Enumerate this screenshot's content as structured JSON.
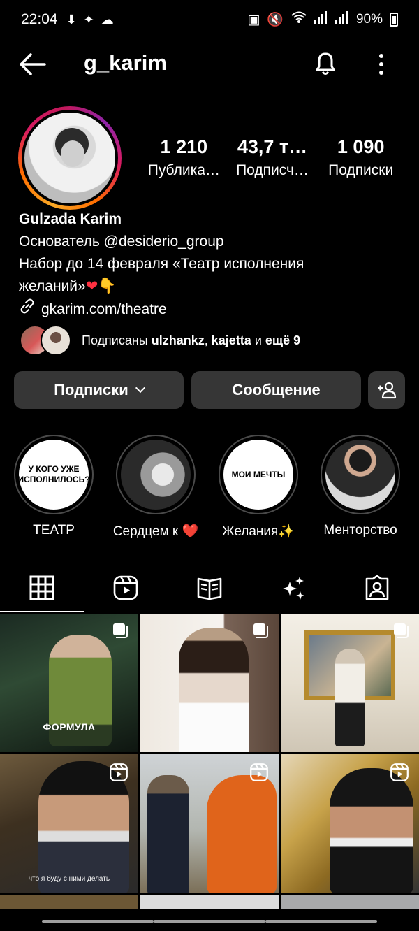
{
  "status_bar": {
    "time": "22:04",
    "battery": "90%"
  },
  "header": {
    "username": "g_karim"
  },
  "stats": [
    {
      "value": "1 210",
      "label": "Публика…"
    },
    {
      "value": "43,7 т…",
      "label": "Подписч…"
    },
    {
      "value": "1 090",
      "label": "Подписки"
    }
  ],
  "bio": {
    "name": "Gulzada Karim",
    "line1": "Основатель @desiderio_group",
    "line2": "Набор до 14 февраля «Театр исполнения",
    "line3_text": "желаний»",
    "link": "gkarim.com/theatre"
  },
  "followed_by": {
    "prefix": "Подписаны ",
    "user1": "ulzhankz",
    "sep": ", ",
    "user2": "kajetta",
    "mid": " и ",
    "more": "ещё 9"
  },
  "buttons": {
    "following": "Подписки",
    "message": "Сообщение"
  },
  "highlights": [
    {
      "label": "ТЕАТР",
      "cover_text": "У КОГО УЖЕ ИСПОЛНИЛОСЬ?"
    },
    {
      "label": "Сердцем к ❤️",
      "cover_text": ""
    },
    {
      "label": "Желания✨",
      "cover_text": "МОИ МЕЧТЫ"
    },
    {
      "label": "Менторство",
      "cover_text": ""
    }
  ],
  "tabs": [
    "grid-icon",
    "reels-icon",
    "guides-icon",
    "effects-icon",
    "tagged-icon"
  ],
  "posts": [
    {
      "caption": "ФОРМУЛА",
      "type": "carousel"
    },
    {
      "caption": "",
      "type": "carousel"
    },
    {
      "caption": "",
      "type": "carousel"
    },
    {
      "caption": "что я буду с ними делать",
      "type": "reel"
    },
    {
      "caption": "",
      "type": "reel"
    },
    {
      "caption": "",
      "type": "reel"
    }
  ],
  "colors": {
    "background": "#000000",
    "button": "#363636",
    "heart": "#ff3040"
  }
}
